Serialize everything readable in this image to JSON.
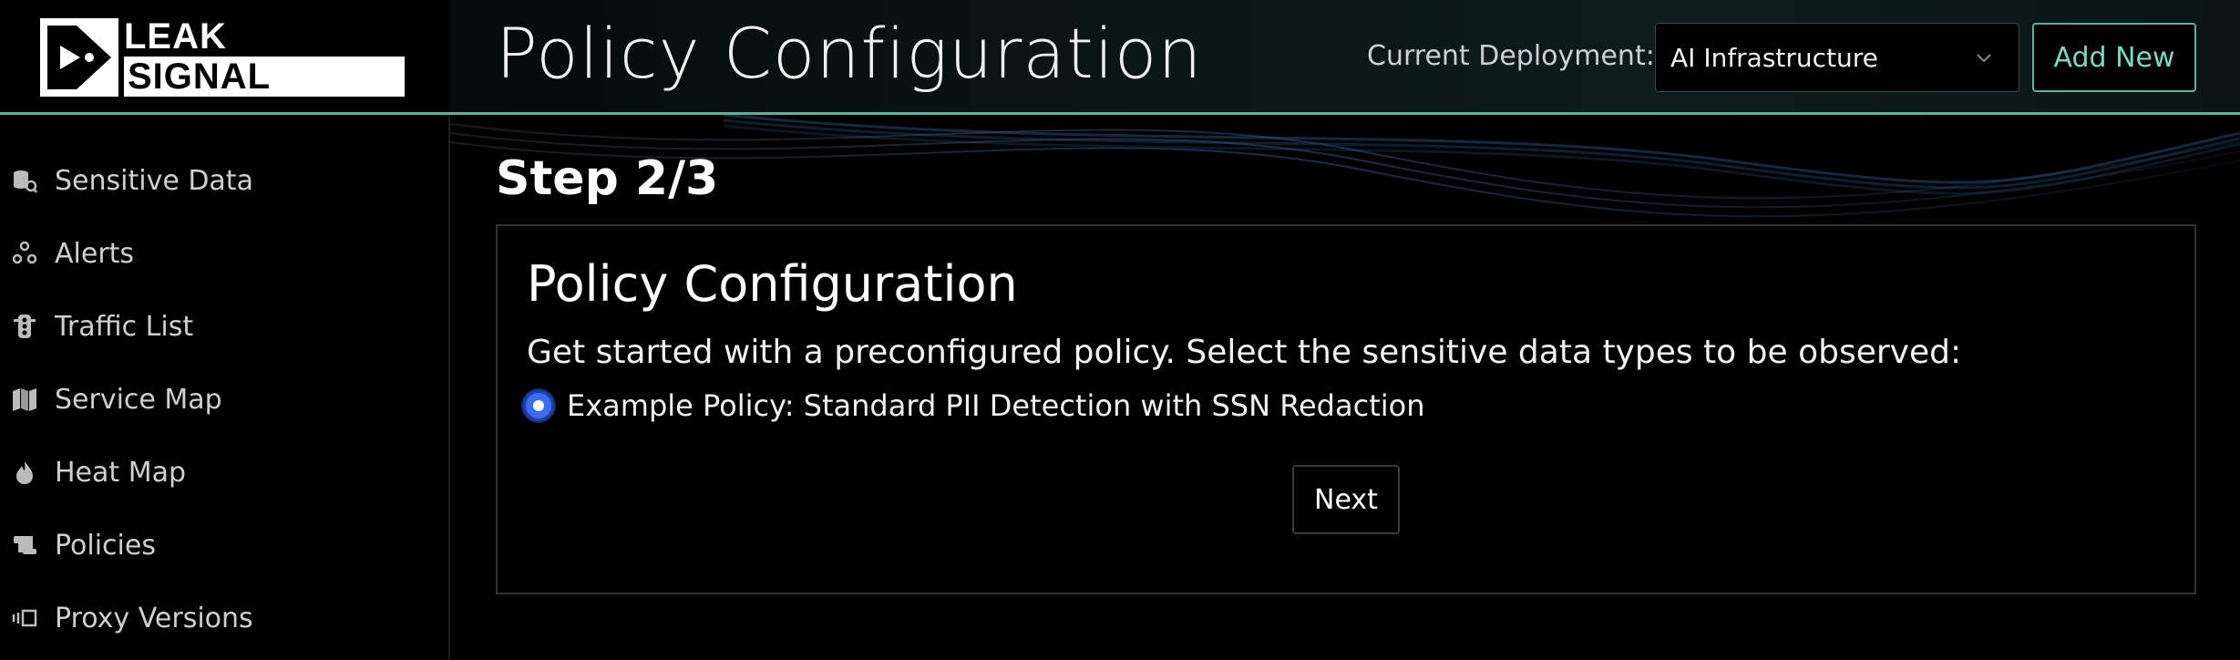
{
  "logo": {
    "line1": "LEAK",
    "line2": "SIGNAL"
  },
  "header": {
    "title": "Policy Configuration",
    "deployment_label": "Current Deployment:",
    "deployment_value": "AI Infrastructure",
    "add_new_label": "Add New"
  },
  "sidebar": {
    "items": [
      {
        "label": "Sensitive Data",
        "icon": "database-icon"
      },
      {
        "label": "Alerts",
        "icon": "alerts-icon"
      },
      {
        "label": "Traffic List",
        "icon": "traffic-light-icon"
      },
      {
        "label": "Service Map",
        "icon": "map-icon"
      },
      {
        "label": "Heat Map",
        "icon": "fire-icon"
      },
      {
        "label": "Policies",
        "icon": "scroll-icon"
      },
      {
        "label": "Proxy Versions",
        "icon": "versions-icon"
      }
    ]
  },
  "main": {
    "step": "Step 2/3",
    "card": {
      "title": "Policy Configuration",
      "description": "Get started with a preconfigured policy. Select the sensitive data types to be observed:",
      "option_label": "Example Policy: Standard PII Detection with SSN Redaction",
      "option_selected": true,
      "next_label": "Next"
    }
  },
  "colors": {
    "accent": "#5ab39a",
    "radio": "#3a6df0",
    "background": "#000000"
  }
}
